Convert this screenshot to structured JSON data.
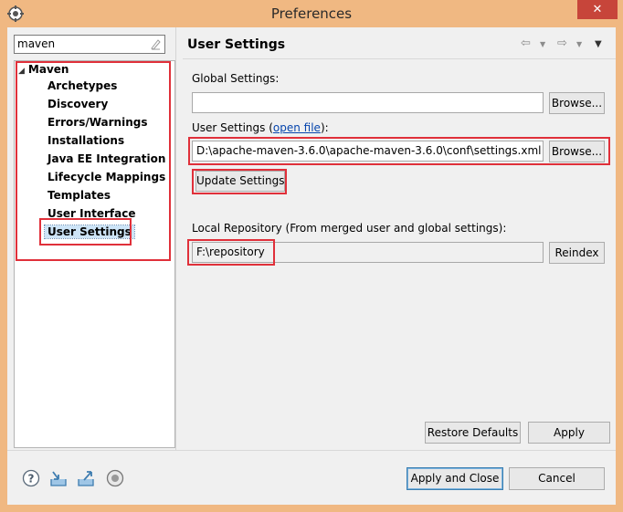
{
  "window": {
    "title": "Preferences",
    "close_glyph": "✕"
  },
  "filter": {
    "value": "maven"
  },
  "tree": {
    "root": "Maven",
    "items": [
      "Archetypes",
      "Discovery",
      "Errors/Warnings",
      "Installations",
      "Java EE Integration",
      "Lifecycle Mappings",
      "Templates",
      "User Interface",
      "User Settings"
    ],
    "selected": "User Settings"
  },
  "page": {
    "title": "User Settings",
    "nav_icons": [
      "back-arrow-icon",
      "chevron-down-icon",
      "forward-arrow-icon",
      "chevron-down-icon",
      "view-menu-icon"
    ],
    "global_settings": {
      "label": "Global Settings:",
      "value": "",
      "browse": "Browse..."
    },
    "user_settings": {
      "label_prefix": "User Settings (",
      "link": "open file",
      "label_suffix": "):",
      "value": "D:\\apache-maven-3.6.0\\apache-maven-3.6.0\\conf\\settings.xml",
      "browse": "Browse..."
    },
    "update_button": "Update Settings",
    "local_repo": {
      "label": "Local Repository (From merged user and global settings):",
      "value": "F:\\repository",
      "reindex": "Reindex"
    },
    "restore_defaults": "Restore Defaults",
    "apply": "Apply"
  },
  "footer": {
    "icons": [
      "help-icon",
      "import-icon",
      "export-icon",
      "oomph-icon"
    ],
    "apply_close": "Apply and Close",
    "cancel": "Cancel"
  },
  "colors": {
    "title_bar": "#f0b882",
    "close_button": "#c7453a",
    "annotation_red": "#e0303a",
    "selection": "#cde4f7"
  }
}
